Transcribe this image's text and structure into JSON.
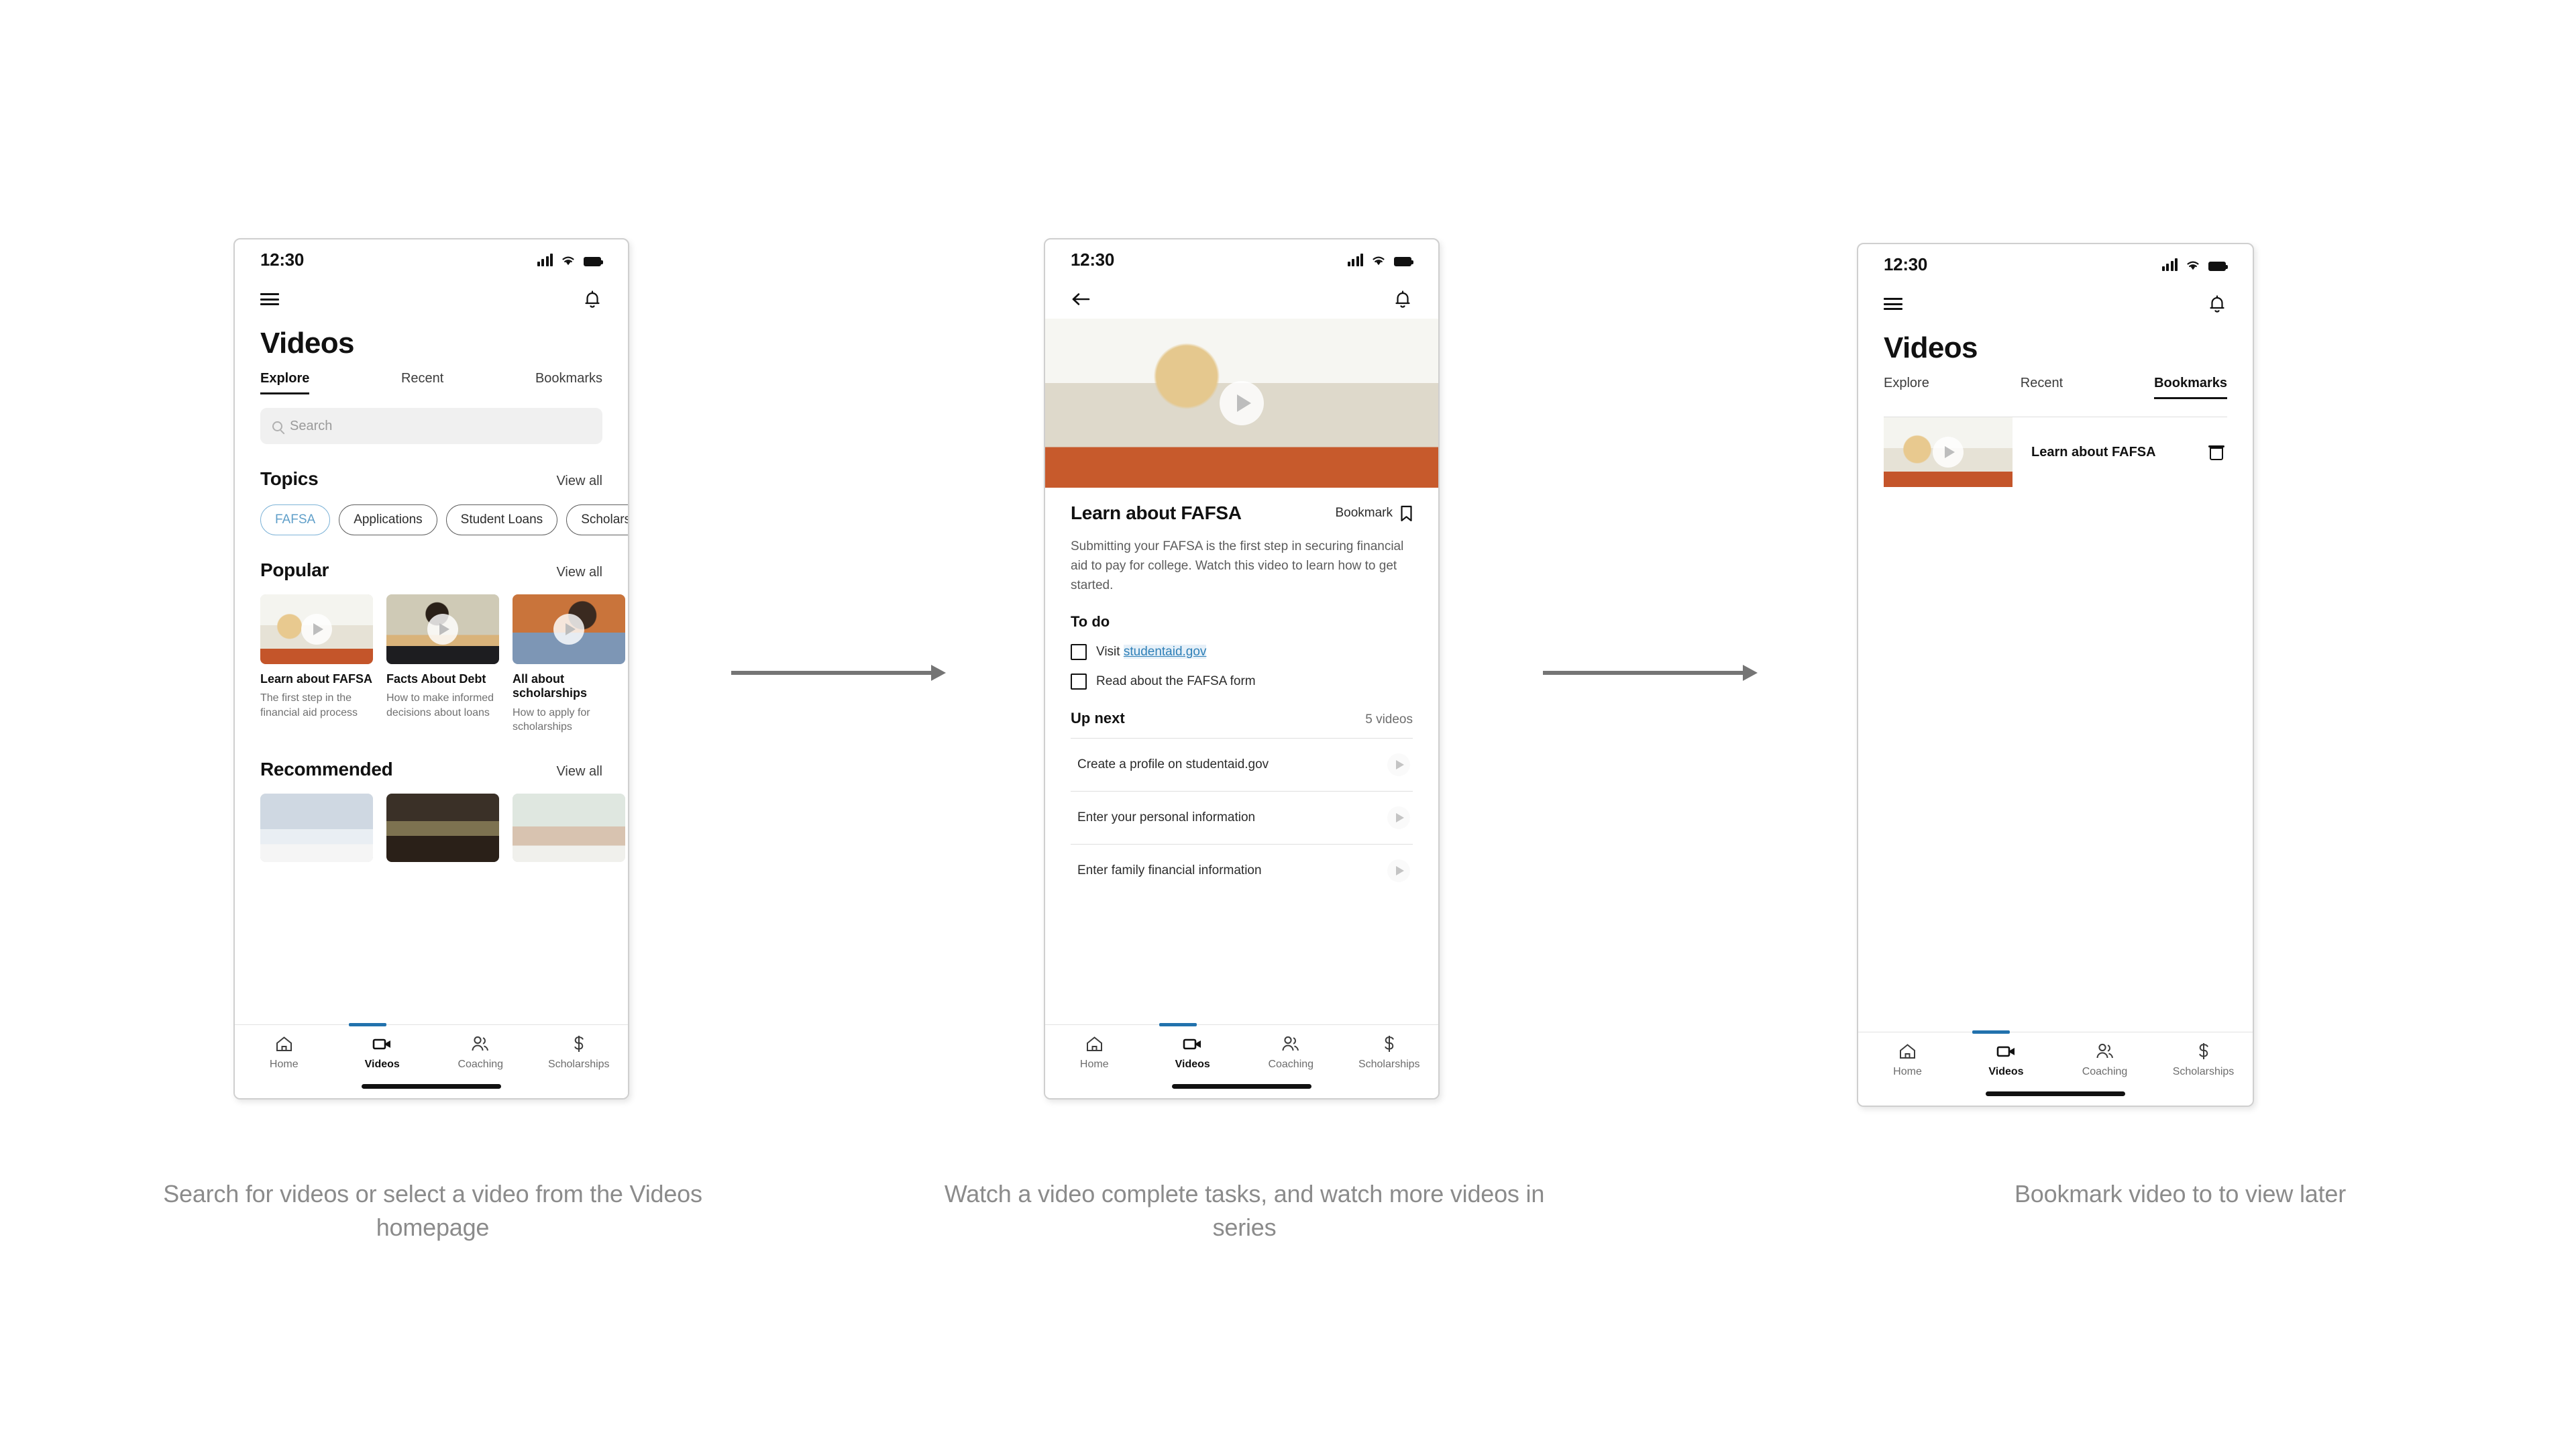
{
  "statusbar": {
    "time": "12:30"
  },
  "nav": {
    "items": [
      {
        "label": "Home",
        "icon": "home-icon"
      },
      {
        "label": "Videos",
        "icon": "video-camera-icon"
      },
      {
        "label": "Coaching",
        "icon": "people-icon"
      },
      {
        "label": "Scholarships",
        "icon": "dollar-icon"
      }
    ],
    "active": "Videos",
    "indicator_color": "#2272ad"
  },
  "screen1": {
    "page_title": "Videos",
    "tabs": [
      {
        "label": "Explore",
        "active": true
      },
      {
        "label": "Recent",
        "active": false
      },
      {
        "label": "Bookmarks",
        "active": false
      }
    ],
    "search": {
      "placeholder": "Search",
      "value": ""
    },
    "topics": {
      "title": "Topics",
      "view_all": "View all",
      "chips": [
        {
          "label": "FAFSA",
          "selected": true
        },
        {
          "label": "Applications",
          "selected": false
        },
        {
          "label": "Student Loans",
          "selected": false
        },
        {
          "label": "Scholarships",
          "selected": false
        }
      ]
    },
    "popular": {
      "title": "Popular",
      "view_all": "View all",
      "cards": [
        {
          "title": "Learn about FAFSA",
          "subtitle": "The first step in the financial aid process"
        },
        {
          "title": "Facts About Debt",
          "subtitle": "How to make informed decisions about loans"
        },
        {
          "title": "All about scholarships",
          "subtitle": "How to apply for scholarships"
        }
      ]
    },
    "recommended": {
      "title": "Recommended",
      "view_all": "View all"
    }
  },
  "screen2": {
    "detail_title": "Learn about FAFSA",
    "bookmark_label": "Bookmark",
    "description": "Submitting your FAFSA is the first step in securing financial aid to pay for college. Watch this video to learn how to get started.",
    "todo": {
      "title": "To do",
      "items": [
        {
          "text_before": "Visit ",
          "link": "studentaid.gov",
          "checked": false
        },
        {
          "text_before": "Read about the FAFSA form",
          "link": "",
          "checked": false
        }
      ]
    },
    "upnext": {
      "title": "Up next",
      "count": "5 videos",
      "items": [
        {
          "label": "Create a profile on studentaid.gov"
        },
        {
          "label": "Enter your personal information"
        },
        {
          "label": "Enter family financial information"
        }
      ]
    }
  },
  "screen3": {
    "page_title": "Videos",
    "tabs": [
      {
        "label": "Explore",
        "active": false
      },
      {
        "label": "Recent",
        "active": false
      },
      {
        "label": "Bookmarks",
        "active": true
      }
    ],
    "bookmarks": [
      {
        "title": "Learn about FAFSA",
        "delete_icon": "trash-icon"
      }
    ]
  },
  "captions": {
    "one": "Search for videos or select a video from the Videos homepage",
    "two": "Watch a video complete tasks, and watch more videos in series",
    "three": "Bookmark video to to view later"
  }
}
